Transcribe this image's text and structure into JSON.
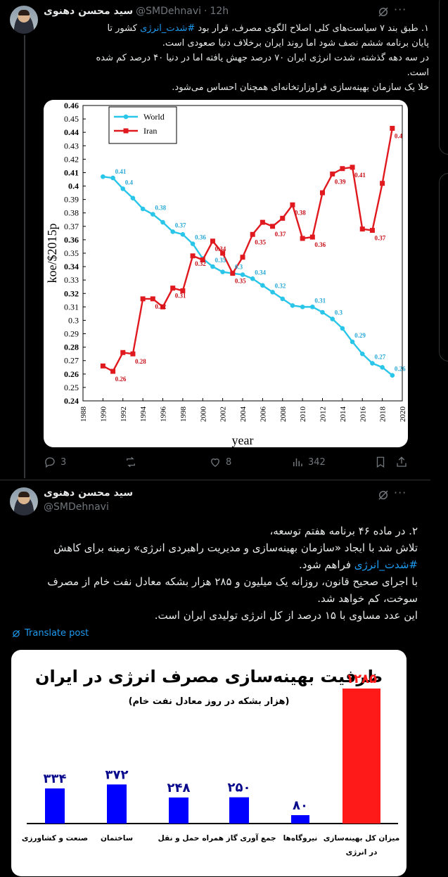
{
  "tweet1": {
    "author_name": "سید محسن دهنوی",
    "author_handle": "@SMDehnavi",
    "separator": "·",
    "time": "12h",
    "lines": [
      {
        "pre": "۱. طبق بند ۷ سیاست‌های کلی اصلاح الگوی مصرف، قرار بود ",
        "tag": "#شدت_انرژی",
        "post": " کشور تا"
      },
      {
        "pre": "پایان برنامه ششم نصف شود اما روند ایران برخلاف دنیا صعودی است.",
        "tag": "",
        "post": ""
      },
      {
        "pre": "در سه دهه گذشته، شدت انرژی ایران ۷۰ درصد جهش یافته اما در دنیا ۴۰ درصد کم شده",
        "tag": "",
        "post": ""
      },
      {
        "pre": "است.",
        "tag": "",
        "post": ""
      },
      {
        "pre": "خلا یک سازمان بهینه‌سازی فراوزارتخانه‌ای همچنان احساس می‌شود.",
        "tag": "",
        "post": ""
      }
    ],
    "actions": {
      "replies": "3",
      "reposts": "",
      "likes": "8",
      "views": "342"
    }
  },
  "chart_data": [
    {
      "type": "line",
      "xlabel": "year",
      "ylabel": "koe/$2015p",
      "ylim": [
        0.24,
        0.46
      ],
      "xlim": [
        1988,
        2020
      ],
      "xticks": [
        "1988",
        "1990",
        "1992",
        "1994",
        "1996",
        "1998",
        "2000",
        "2002",
        "2004",
        "2006",
        "2008",
        "2010",
        "2012",
        "2014",
        "2016",
        "2018",
        "2020"
      ],
      "yticks": [
        "0.24",
        "0.25",
        "0.26",
        "0.27",
        "0.28",
        "0.29",
        "0.3",
        "0.31",
        "0.32",
        "0.33",
        "0.34",
        "0.35",
        "0.36",
        "0.37",
        "0.38",
        "0.39",
        "0.4",
        "0.41",
        "0.42",
        "0.43",
        "0.44",
        "0.45",
        "0.46"
      ],
      "bold_yticks": [
        "0.24",
        "0.26",
        "0.28",
        "0.32",
        "0.34",
        "0.36",
        "0.4",
        "0.41",
        "0.44",
        "0.46"
      ],
      "legend_position": "top-left",
      "series": [
        {
          "name": "World",
          "color": "#29c6ea",
          "marker": "circle",
          "x": [
            1990,
            1991,
            1992,
            1993,
            1994,
            1995,
            1996,
            1997,
            1998,
            1999,
            2000,
            2001,
            2002,
            2003,
            2004,
            2005,
            2006,
            2007,
            2008,
            2009,
            2010,
            2011,
            2012,
            2013,
            2014,
            2015,
            2016,
            2017,
            2018,
            2019
          ],
          "y": [
            0.407,
            0.406,
            0.398,
            0.391,
            0.383,
            0.379,
            0.373,
            0.366,
            0.364,
            0.357,
            0.346,
            0.34,
            0.336,
            0.335,
            0.334,
            0.331,
            0.326,
            0.321,
            0.316,
            0.311,
            0.31,
            0.31,
            0.306,
            0.301,
            0.294,
            0.284,
            0.275,
            0.268,
            0.265,
            0.259
          ]
        },
        {
          "name": "Iran",
          "color": "#e0191f",
          "marker": "square",
          "x": [
            1990,
            1991,
            1992,
            1993,
            1994,
            1995,
            1996,
            1997,
            1998,
            1999,
            2000,
            2001,
            2002,
            2003,
            2004,
            2005,
            2006,
            2007,
            2008,
            2009,
            2010,
            2011,
            2012,
            2013,
            2014,
            2015,
            2016,
            2017,
            2018,
            2019
          ],
          "y": [
            0.266,
            0.262,
            0.276,
            0.275,
            0.316,
            0.316,
            0.31,
            0.324,
            0.322,
            0.348,
            0.345,
            0.359,
            0.35,
            0.335,
            0.347,
            0.364,
            0.373,
            0.37,
            0.376,
            0.386,
            0.361,
            0.362,
            0.395,
            0.409,
            0.413,
            0.414,
            0.368,
            0.367,
            0.402,
            0.443
          ]
        }
      ],
      "labels": [
        {
          "series": "World",
          "x": 1991,
          "y": 0.41,
          "text": "0.41"
        },
        {
          "series": "World",
          "x": 1992,
          "y": 0.4,
          "text": "0.4"
        },
        {
          "series": "World",
          "x": 1995,
          "y": 0.38,
          "text": "0.38"
        },
        {
          "series": "World",
          "x": 1997,
          "y": 0.37,
          "text": "0.37"
        },
        {
          "series": "World",
          "x": 1999,
          "y": 0.36,
          "text": "0.36"
        },
        {
          "series": "World",
          "x": 2001,
          "y": 0.35,
          "text": "0.35"
        },
        {
          "series": "World",
          "x": 2003,
          "y": 0.3,
          "text": "0.3"
        },
        {
          "series": "World",
          "x": 2005,
          "y": 0.34,
          "text": "0.34"
        },
        {
          "series": "World",
          "x": 2007,
          "y": 0.32,
          "text": "0.32"
        },
        {
          "series": "World",
          "x": 2011,
          "y": 0.31,
          "text": "0.31"
        },
        {
          "series": "World",
          "x": 2013,
          "y": 0.3,
          "text": "0.3"
        },
        {
          "series": "World",
          "x": 2015,
          "y": 0.29,
          "text": "0.29"
        },
        {
          "series": "World",
          "x": 2017,
          "y": 0.27,
          "text": "0.27"
        },
        {
          "series": "World",
          "x": 2019,
          "y": 0.26,
          "text": "0.26"
        },
        {
          "series": "Iran",
          "x": 1991,
          "y": 0.26,
          "text": "0.26"
        },
        {
          "series": "Iran",
          "x": 1993,
          "y": 0.28,
          "text": "0.28"
        },
        {
          "series": "Iran",
          "x": 1995,
          "y": 0.32,
          "text": "0.32"
        },
        {
          "series": "Iran",
          "x": 1997,
          "y": 0.31,
          "text": "0.31"
        },
        {
          "series": "Iran",
          "x": 1999,
          "y": 0.32,
          "text": "0.32"
        },
        {
          "series": "Iran",
          "x": 2001,
          "y": 0.34,
          "text": "0.34"
        },
        {
          "series": "Iran",
          "x": 2003,
          "y": 0.35,
          "text": "0.35"
        },
        {
          "series": "Iran",
          "x": 2005,
          "y": 0.35,
          "text": "0.35"
        },
        {
          "series": "Iran",
          "x": 2007,
          "y": 0.37,
          "text": "0.37"
        },
        {
          "series": "Iran",
          "x": 2009,
          "y": 0.38,
          "text": "0.38"
        },
        {
          "series": "Iran",
          "x": 2011,
          "y": 0.36,
          "text": "0.36"
        },
        {
          "series": "Iran",
          "x": 2013,
          "y": 0.39,
          "text": "0.39"
        },
        {
          "series": "Iran",
          "x": 2015,
          "y": 0.41,
          "text": "0.41"
        },
        {
          "series": "Iran",
          "x": 2017,
          "y": 0.37,
          "text": "0.37"
        },
        {
          "series": "Iran",
          "x": 2019,
          "y": 0.4,
          "text": "0.4"
        }
      ]
    },
    {
      "type": "bar",
      "title": "ظرفیت بهینه‌سازی مصرف انرژی در ایران",
      "subtitle": "(هزار بشکه در روز معادل نفت خام)",
      "categories": [
        "میزان کل بهینه‌سازی در انرژی",
        "نیروگاه‌ها",
        "جمع آوری گاز همراه",
        "حمل و نقل",
        "ساختمان",
        "صنعت و کشاورزی"
      ],
      "values": [
        1285,
        80,
        250,
        248,
        372,
        334
      ],
      "value_labels": [
        "۱۲۸۵",
        "۸۰",
        "۲۵۰",
        "۲۴۸",
        "۳۷۲",
        "۳۳۴"
      ],
      "colors": [
        "#ff1a1a",
        "#0000ff",
        "#0000ff",
        "#0000ff",
        "#0000ff",
        "#0000ff"
      ],
      "label_colors": [
        "#ff1a1a",
        "#0a0a8c",
        "#0a0a8c",
        "#0a0a8c",
        "#0a0a8c",
        "#0a0a8c"
      ]
    }
  ],
  "tweet2": {
    "author_name": "سید محسن دهنوی",
    "author_handle": "@SMDehnavi",
    "lines": [
      {
        "pre": "۲. در ماده ۴۶ برنامه هفتم توسعه،",
        "tag": "",
        "post": ""
      },
      {
        "pre": "تلاش شد با ایجاد «سازمان بهینه‌سازی و مدیریت راهبردی انرژی» زمینه برای کاهش",
        "tag": "",
        "post": ""
      },
      {
        "pre": "",
        "tag": "#شدت_انرژی",
        "post": " فراهم شود."
      },
      {
        "pre": "با اجرای صحیح قانون، روزانه یک میلیون و ۲۸۵ هزار بشکه معادل نفت خام از مصرف",
        "tag": "",
        "post": ""
      },
      {
        "pre": "سوخت، کم خواهد شد.",
        "tag": "",
        "post": ""
      },
      {
        "pre": "این عدد مساوی با ۱۵ درصد از کل انرژی تولیدی ایران است.",
        "tag": "",
        "post": ""
      }
    ],
    "translate_label": "Translate post"
  },
  "colors": {
    "background": "#000000",
    "text": "#e7e9ea",
    "muted": "#71767b",
    "link": "#1d9bf0",
    "border": "#2f3336"
  }
}
